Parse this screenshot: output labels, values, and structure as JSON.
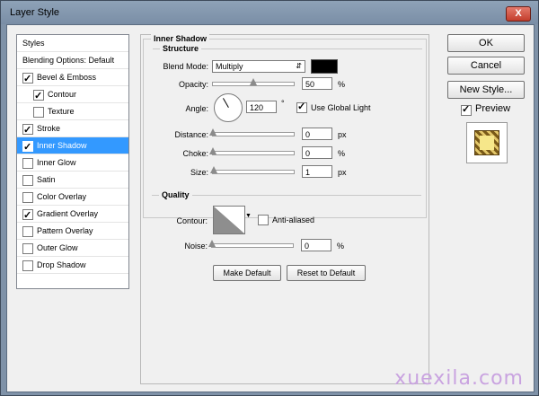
{
  "window": {
    "title": "Layer Style",
    "close_glyph": "X"
  },
  "styles_list": [
    {
      "label": "Styles",
      "check": null,
      "indent": 0,
      "selected": false
    },
    {
      "label": "Blending Options: Default",
      "check": null,
      "indent": 0,
      "selected": false
    },
    {
      "label": "Bevel & Emboss",
      "check": true,
      "indent": 0,
      "selected": false
    },
    {
      "label": "Contour",
      "check": true,
      "indent": 1,
      "selected": false
    },
    {
      "label": "Texture",
      "check": false,
      "indent": 1,
      "selected": false
    },
    {
      "label": "Stroke",
      "check": true,
      "indent": 0,
      "selected": false
    },
    {
      "label": "Inner Shadow",
      "check": true,
      "indent": 0,
      "selected": true
    },
    {
      "label": "Inner Glow",
      "check": false,
      "indent": 0,
      "selected": false
    },
    {
      "label": "Satin",
      "check": false,
      "indent": 0,
      "selected": false
    },
    {
      "label": "Color Overlay",
      "check": false,
      "indent": 0,
      "selected": false
    },
    {
      "label": "Gradient Overlay",
      "check": true,
      "indent": 0,
      "selected": false
    },
    {
      "label": "Pattern Overlay",
      "check": false,
      "indent": 0,
      "selected": false
    },
    {
      "label": "Outer Glow",
      "check": false,
      "indent": 0,
      "selected": false
    },
    {
      "label": "Drop Shadow",
      "check": false,
      "indent": 0,
      "selected": false
    }
  ],
  "inner_shadow": {
    "title": "Inner Shadow",
    "structure": {
      "title": "Structure",
      "blend_mode_label": "Blend Mode:",
      "blend_mode_value": "Multiply",
      "blend_color": "#000000",
      "opacity_label": "Opacity:",
      "opacity_value": "50",
      "opacity_unit": "%",
      "opacity_level": 0.5,
      "angle_label": "Angle:",
      "angle_value": "120",
      "angle_unit": "°",
      "use_global_light_label": "Use Global Light",
      "use_global_light": true,
      "distance_label": "Distance:",
      "distance_value": "0",
      "distance_unit": "px",
      "choke_label": "Choke:",
      "choke_value": "0",
      "choke_unit": "%",
      "size_label": "Size:",
      "size_value": "1",
      "size_unit": "px"
    },
    "quality": {
      "title": "Quality",
      "contour_label": "Contour:",
      "anti_aliased_label": "Anti-aliased",
      "anti_aliased": false,
      "noise_label": "Noise:",
      "noise_value": "0",
      "noise_unit": "%"
    },
    "make_default_label": "Make Default",
    "reset_default_label": "Reset to Default"
  },
  "right": {
    "ok_label": "OK",
    "cancel_label": "Cancel",
    "new_style_label": "New Style...",
    "preview_label": "Preview",
    "preview_checked": true
  },
  "watermark": "xuexila.com"
}
